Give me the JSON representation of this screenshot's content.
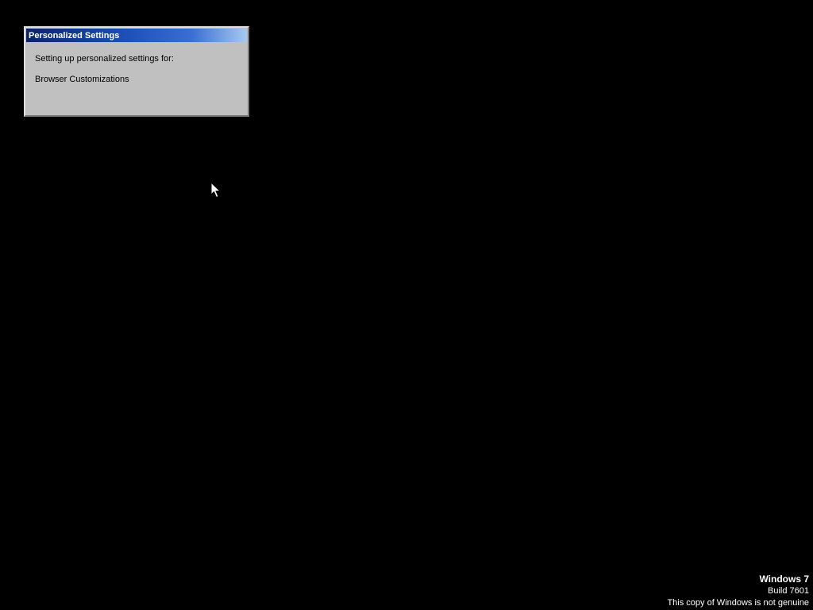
{
  "dialog": {
    "title": "Personalized Settings",
    "message": "Setting up personalized settings for:",
    "component": "Browser Customizations"
  },
  "watermark": {
    "product": "Windows 7",
    "build": "Build 7601",
    "notice": "This copy of Windows is not genuine"
  },
  "icons": {
    "cursor": "mouse-pointer-icon"
  },
  "colors": {
    "desktop_background": "#000000",
    "dialog_background": "#c0c0c0",
    "titlebar_start": "#0a246a",
    "titlebar_end": "#a6caf0",
    "text_light": "#ffffff",
    "text_dark": "#000000"
  }
}
